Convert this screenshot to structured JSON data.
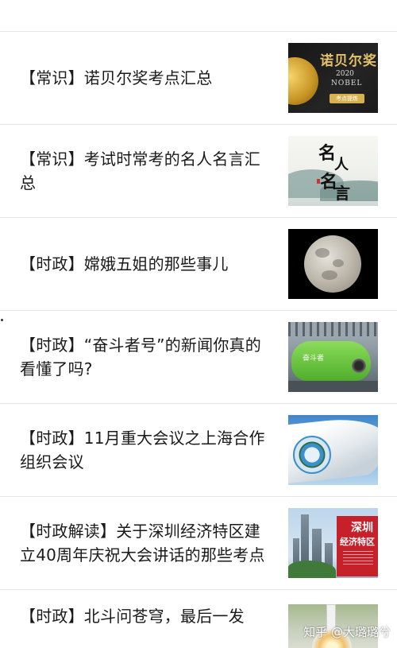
{
  "top_fragment": {
    "cut_text": ""
  },
  "articles": [
    {
      "title": "【常识】诺贝尔奖考点汇总",
      "thumb_icon": "nobel-prize-image",
      "thumb_text": {
        "head": "诺贝尔奖",
        "year": "2020",
        "word": "NOBEL",
        "tag": "考点提炼"
      }
    },
    {
      "title": "【常识】考试时常考的名人名言汇总",
      "thumb_icon": "famous-quotes-image",
      "thumb_text": {
        "c1": "名",
        "c2": "人",
        "c3": "名",
        "c4": "言"
      }
    },
    {
      "title": "【时政】嫦娥五姐的那些事儿",
      "thumb_icon": "moon-image"
    },
    {
      "title": "【时政】“奋斗者号”的新闻你真的看懂了吗?",
      "thumb_icon": "submersible-image",
      "thumb_text": {
        "label": "奋斗者"
      }
    },
    {
      "title": "【时政】11月重大会议之上海合作组织会议",
      "thumb_icon": "sco-flag-image"
    },
    {
      "title": "【时政解读】关于深圳经济特区建立40周年庆祝大会讲话的那些考点",
      "thumb_icon": "shenzhen-image",
      "thumb_text": {
        "p1": "深圳",
        "p2": "经济特区"
      }
    },
    {
      "title": "【时政】北斗问苍穹，最后一发",
      "thumb_icon": "rocket-launch-image"
    }
  ],
  "watermark": "知乎 @大璐璐兮",
  "colors": {
    "divider": "#e6e6e6",
    "text": "#1a1a1a"
  }
}
